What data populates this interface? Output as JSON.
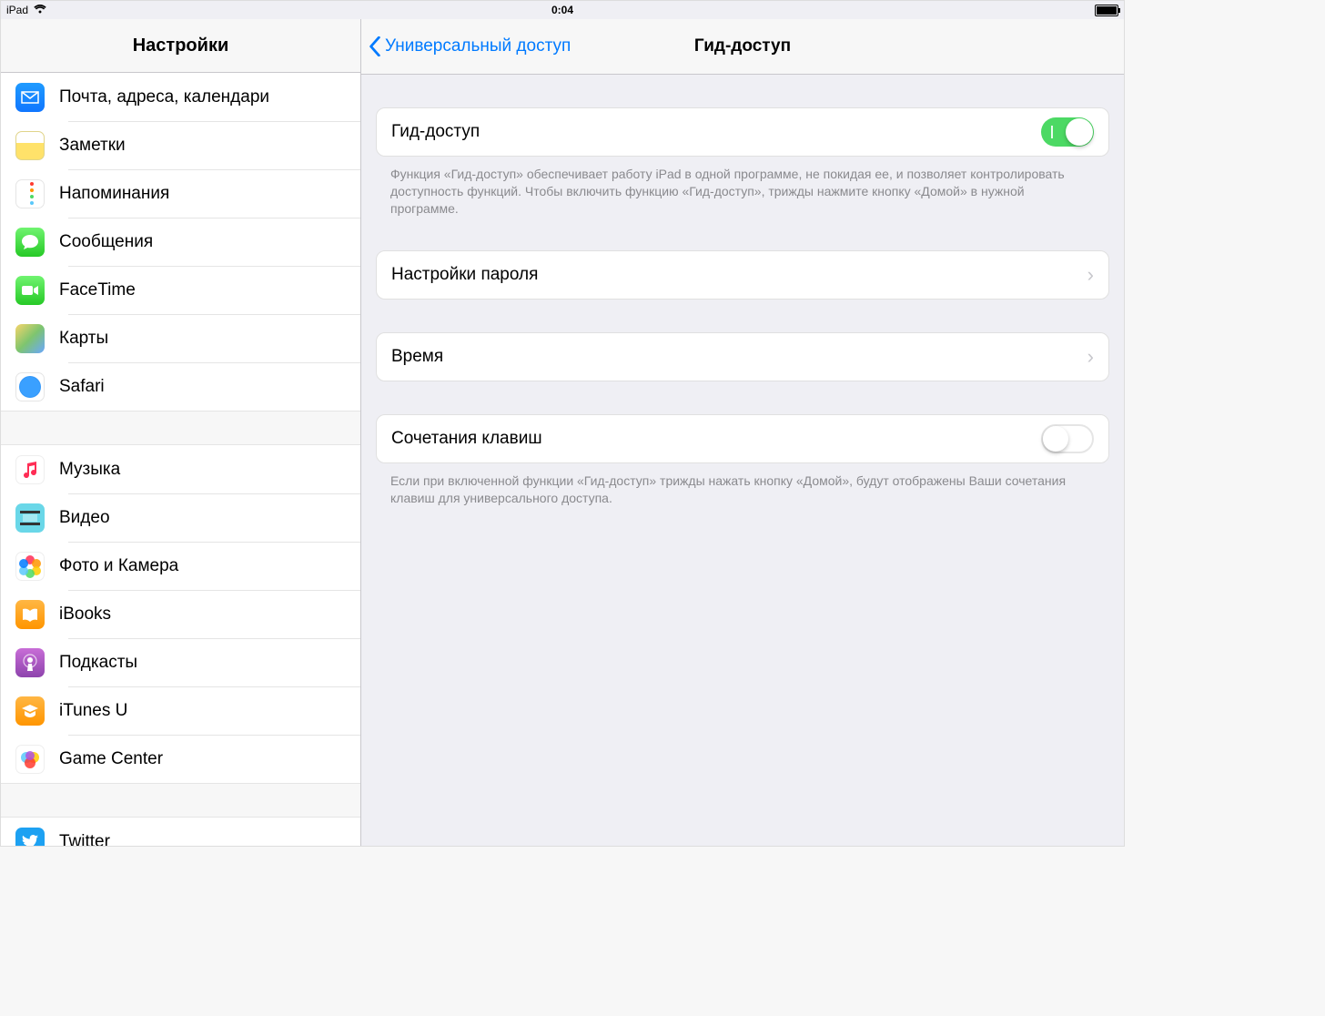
{
  "status": {
    "device": "iPad",
    "time": "0:04"
  },
  "sidebar": {
    "title": "Настройки",
    "group1": [
      {
        "label": "Почта, адреса, календари"
      },
      {
        "label": "Заметки"
      },
      {
        "label": "Напоминания"
      },
      {
        "label": "Сообщения"
      },
      {
        "label": "FaceTime"
      },
      {
        "label": "Карты"
      },
      {
        "label": "Safari"
      }
    ],
    "group2": [
      {
        "label": "Музыка"
      },
      {
        "label": "Видео"
      },
      {
        "label": "Фото и Камера"
      },
      {
        "label": "iBooks"
      },
      {
        "label": "Подкасты"
      },
      {
        "label": "iTunes U"
      },
      {
        "label": "Game Center"
      }
    ],
    "group3": [
      {
        "label": "Twitter"
      }
    ]
  },
  "detail": {
    "back": "Универсальный доступ",
    "title": "Гид-доступ",
    "guided_access": {
      "label": "Гид-доступ",
      "on": true
    },
    "guided_footer": "Функция «Гид-доступ» обеспечивает работу iPad в одной программе, не покидая ее, и позволяет контролировать доступность функций. Чтобы включить функцию «Гид-доступ», трижды нажмите кнопку «Домой» в нужной программе.",
    "passcode": {
      "label": "Настройки пароля"
    },
    "time": {
      "label": "Время"
    },
    "shortcuts": {
      "label": "Сочетания клавиш",
      "on": false
    },
    "shortcuts_footer": "Если при включенной функции «Гид-доступ» трижды нажать кнопку «Домой», будут отображены Ваши сочетания клавиш для универсального доступа."
  }
}
